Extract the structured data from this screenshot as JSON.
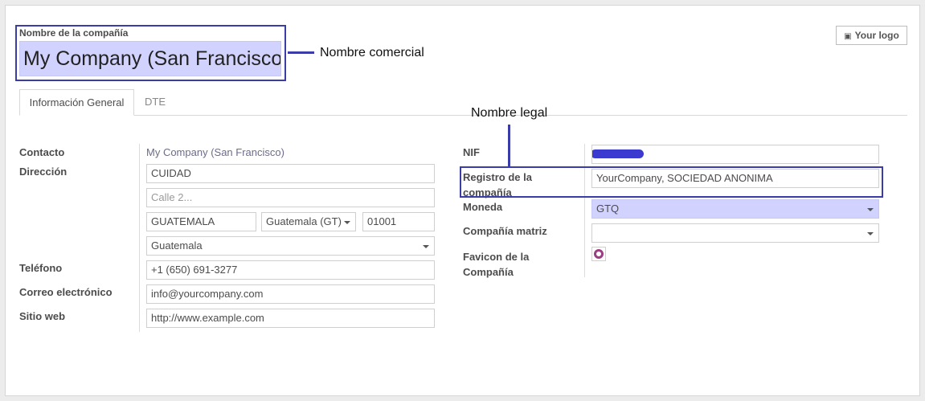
{
  "header": {
    "company_name_label": "Nombre de la compañía",
    "company_name_value": "My Company (San Francisco)",
    "logo_button": "Your logo"
  },
  "tabs": [
    {
      "label": "Información General",
      "active": true
    },
    {
      "label": "DTE",
      "active": false
    }
  ],
  "left": {
    "contact_label": "Contacto",
    "contact_value": "My Company (San Francisco)",
    "address_label": "Dirección",
    "street": "CUIDAD",
    "street2_placeholder": "Calle 2...",
    "city": "GUATEMALA",
    "state": "Guatemala (GT)",
    "zip": "01001",
    "country": "Guatemala",
    "phone_label": "Teléfono",
    "phone_value": "+1 (650) 691-3277",
    "email_label": "Correo electrónico",
    "email_value": "info@yourcompany.com",
    "website_label": "Sitio web",
    "website_value": "http://www.example.com"
  },
  "right": {
    "nif_label": "NIF",
    "registry_label": "Registro de la compañía",
    "registry_value": "YourCompany, SOCIEDAD ANONIMA",
    "currency_label": "Moneda",
    "currency_value": "GTQ",
    "parent_label": "Compañía matriz",
    "parent_value": "",
    "favicon_label": "Favicon de la Compañía"
  },
  "annotations": {
    "commercial_name": "Nombre comercial",
    "legal_name": "Nombre legal"
  },
  "colors": {
    "highlight": "#3c3ca8",
    "required_field": "#d2d2ff",
    "favicon_ring": "#9b3f82"
  }
}
